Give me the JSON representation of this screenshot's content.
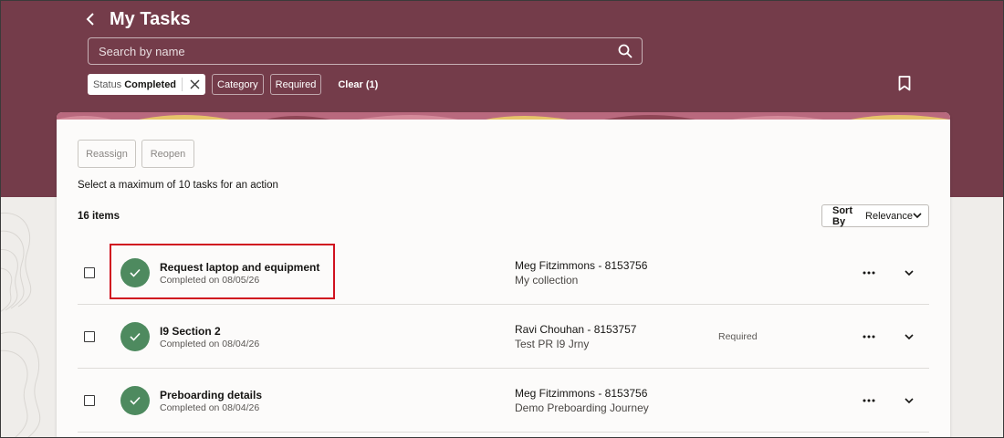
{
  "header": {
    "title": "My Tasks",
    "search_placeholder": "Search by name"
  },
  "filters": {
    "active_chip": {
      "key": "Status",
      "value": "Completed"
    },
    "chips": [
      "Category",
      "Required"
    ],
    "clear_label": "Clear (1)"
  },
  "toolbar": {
    "reassign_label": "Reassign",
    "reopen_label": "Reopen",
    "hint": "Select a maximum of 10 tasks for an action",
    "count": "16 items",
    "sort_key": "Sort By",
    "sort_value": "Relevance"
  },
  "tasks": [
    {
      "name": "Request laptop and equipment",
      "date": "Completed on 08/05/26",
      "assignee": "Meg Fitzimmons - 8153756",
      "journey": "My collection",
      "required": ""
    },
    {
      "name": "I9 Section 2",
      "date": "Completed on 08/04/26",
      "assignee": "Ravi Chouhan - 8153757",
      "journey": "Test PR I9 Jrny",
      "required": "Required"
    },
    {
      "name": "Preboarding details",
      "date": "Completed on 08/04/26",
      "assignee": "Meg Fitzimmons - 8153756",
      "journey": "Demo Preboarding Journey",
      "required": ""
    }
  ],
  "colors": {
    "banner": "#743c4a",
    "status_complete": "#4e8a5f",
    "highlight": "#d0121f"
  },
  "icons": {
    "back": "chevron-left-icon",
    "search": "search-icon",
    "close": "close-icon",
    "bookmark": "bookmark-icon",
    "check": "check-icon",
    "more": "more-horizontal-icon",
    "expand": "chevron-down-icon"
  }
}
